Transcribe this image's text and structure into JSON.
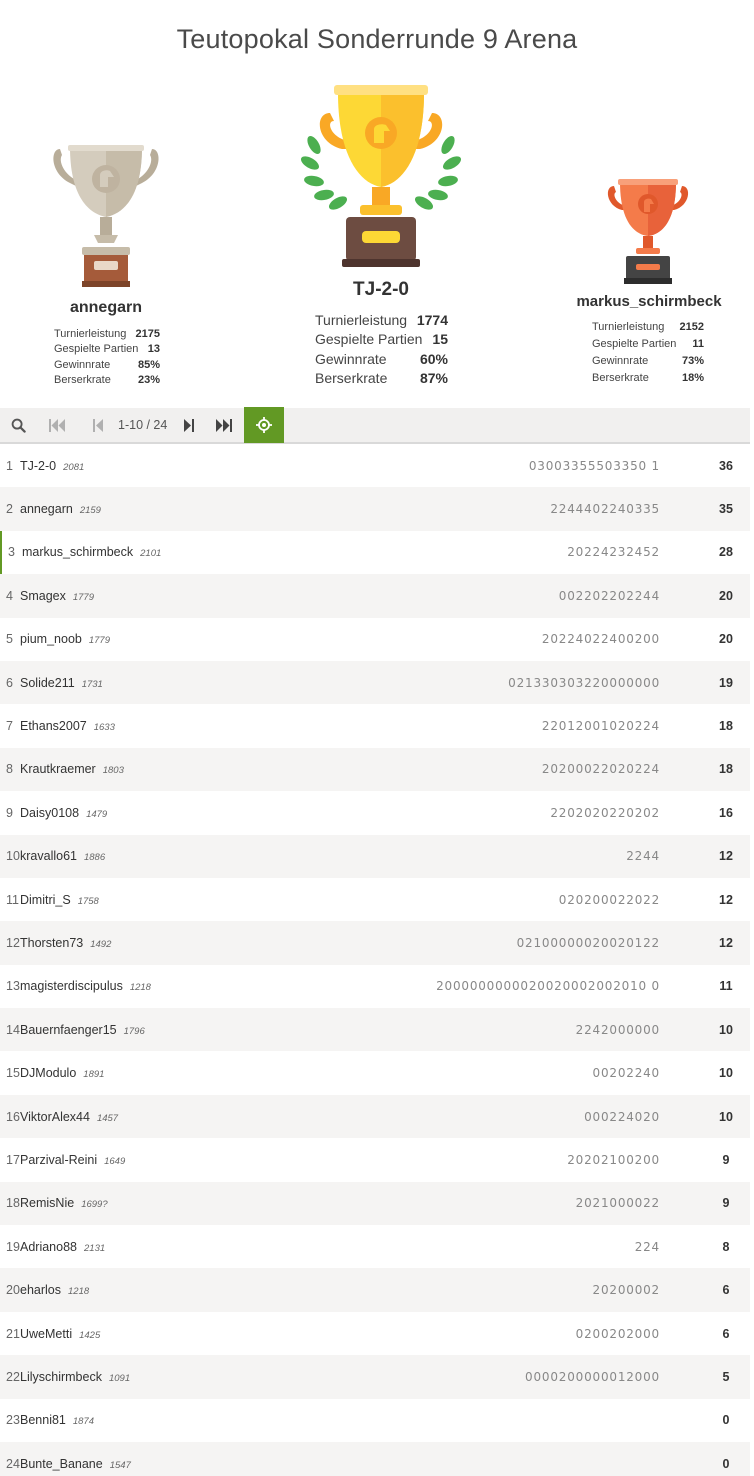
{
  "title": "Teutopokal Sonderrunde 9 Arena",
  "podium": [
    {
      "place": 2,
      "name": "annegarn",
      "trophy_color": "#c9c0b0",
      "stats": [
        {
          "label": "Turnierleistung",
          "value": "2175"
        },
        {
          "label": "Gespielte Partien",
          "value": "13"
        },
        {
          "label": "Gewinnrate",
          "value": "85%"
        },
        {
          "label": "Berserkrate",
          "value": "23%"
        }
      ]
    },
    {
      "place": 1,
      "name": "TJ-2-0",
      "trophy_color": "#fbc02d",
      "stats": [
        {
          "label": "Turnierleistung",
          "value": "1774"
        },
        {
          "label": "Gespielte Partien",
          "value": "15"
        },
        {
          "label": "Gewinnrate",
          "value": "60%"
        },
        {
          "label": "Berserkrate",
          "value": "87%"
        }
      ]
    },
    {
      "place": 3,
      "name": "markus_schirmbeck",
      "trophy_color": "#f26b3a",
      "stats": [
        {
          "label": "Turnierleistung",
          "value": "2152"
        },
        {
          "label": "Gespielte Partien",
          "value": "11"
        },
        {
          "label": "Gewinnrate",
          "value": "73%"
        },
        {
          "label": "Berserkrate",
          "value": "18%"
        }
      ]
    }
  ],
  "toolbar": {
    "search_icon": "search-icon",
    "first_icon": "first-page-icon",
    "prev_icon": "prev-page-icon",
    "page_label": "1-10 / 24",
    "next_icon": "next-page-icon",
    "last_icon": "last-page-icon",
    "me_icon": "target-icon",
    "accent": "#629924"
  },
  "colors": {
    "double": "#7a9b2f",
    "fire": "#b6932b",
    "normal": "#888888"
  },
  "players": [
    {
      "rank": "1",
      "name": "TJ-2-0",
      "rating": "2081",
      "sheet": "03003355503350 1",
      "total": "36"
    },
    {
      "rank": "2",
      "name": "annegarn",
      "rating": "2159",
      "sheet": "2244402240335",
      "total": "35"
    },
    {
      "rank": "3",
      "name": "markus_schirmbeck",
      "rating": "2101",
      "sheet": "20224232452",
      "total": "28"
    },
    {
      "rank": "4",
      "name": "Smagex",
      "rating": "1779",
      "sheet": "002202202244",
      "total": "20"
    },
    {
      "rank": "5",
      "name": "pium_noob",
      "rating": "1779",
      "sheet": "20224022400200",
      "total": "20"
    },
    {
      "rank": "6",
      "name": "Solide211",
      "rating": "1731",
      "sheet": "021330303220000000",
      "total": "19"
    },
    {
      "rank": "7",
      "name": "Ethans2007",
      "rating": "1633",
      "sheet": "22012001020224",
      "total": "18"
    },
    {
      "rank": "8",
      "name": "Krautkraemer",
      "rating": "1803",
      "sheet": "20200022020224",
      "total": "18"
    },
    {
      "rank": "9",
      "name": "Daisy0108",
      "rating": "1479",
      "sheet": "2202020220202",
      "total": "16"
    },
    {
      "rank": "10",
      "name": "kravallo61",
      "rating": "1886",
      "sheet": "2244",
      "total": "12"
    },
    {
      "rank": "11",
      "name": "Dimitri_S",
      "rating": "1758",
      "sheet": "020200022022",
      "total": "12"
    },
    {
      "rank": "12",
      "name": "Thorsten73",
      "rating": "1492",
      "sheet": "02100000020020122",
      "total": "12"
    },
    {
      "rank": "13",
      "name": "magisterdiscipulus",
      "rating": "1218",
      "sheet": "2000000000020020002002010 0",
      "total": "11"
    },
    {
      "rank": "14",
      "name": "Bauernfaenger15",
      "rating": "1796",
      "sheet": "2242000000",
      "total": "10"
    },
    {
      "rank": "15",
      "name": "DJModulo",
      "rating": "1891",
      "sheet": "00202240",
      "total": "10"
    },
    {
      "rank": "16",
      "name": "ViktorAlex44",
      "rating": "1457",
      "sheet": "000224020",
      "total": "10"
    },
    {
      "rank": "17",
      "name": "Parzival-Reini",
      "rating": "1649",
      "sheet": "20202100200",
      "total": "9"
    },
    {
      "rank": "18",
      "name": "RemisNie",
      "rating": "1699?",
      "sheet": "2021000022",
      "total": "9"
    },
    {
      "rank": "19",
      "name": "Adriano88",
      "rating": "2131",
      "sheet": "224",
      "total": "8"
    },
    {
      "rank": "20",
      "name": "eharlos",
      "rating": "1218",
      "sheet": "20200002",
      "total": "6"
    },
    {
      "rank": "21",
      "name": "UweMetti",
      "rating": "1425",
      "sheet": "0200202000",
      "total": "6"
    },
    {
      "rank": "22",
      "name": "Lilyschirmbeck",
      "rating": "1091",
      "sheet": "0000200000012000",
      "total": "5"
    },
    {
      "rank": "23",
      "name": "Benni81",
      "rating": "1874",
      "sheet": "",
      "total": "0"
    },
    {
      "rank": "24",
      "name": "Bunte_Banane",
      "rating": "1547",
      "sheet": "",
      "total": "0"
    }
  ]
}
